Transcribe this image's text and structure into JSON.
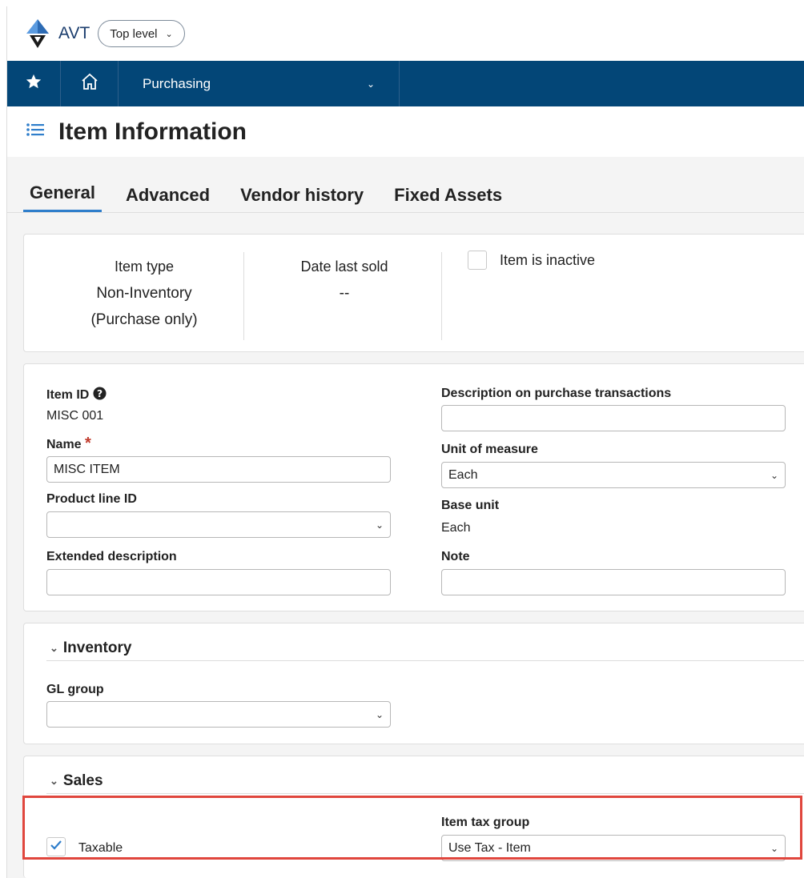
{
  "header": {
    "app_name": "AVT",
    "level_button": "Top level",
    "chevron": "⌄"
  },
  "nav": {
    "star_icon": "star-icon",
    "home_icon": "home-icon",
    "module": "Purchasing",
    "module_chevron": "⌄"
  },
  "page": {
    "title": "Item Information"
  },
  "tabs": [
    {
      "label": "General",
      "active": true
    },
    {
      "label": "Advanced",
      "active": false
    },
    {
      "label": "Vendor history",
      "active": false
    },
    {
      "label": "Fixed Assets",
      "active": false
    }
  ],
  "summary": {
    "item_type_label": "Item type",
    "item_type_value_1": "Non-Inventory",
    "item_type_value_2": "(Purchase only)",
    "date_last_sold_label": "Date last sold",
    "date_last_sold_value": "--",
    "inactive_label": "Item is inactive"
  },
  "general": {
    "item_id_label": "Item ID",
    "item_id_value": "MISC 001",
    "name_label": "Name",
    "required_mark": "*",
    "name_value": "MISC ITEM",
    "product_line_label": "Product line ID",
    "product_line_value": "",
    "extended_desc_label": "Extended description",
    "extended_desc_value": "",
    "purchase_desc_label": "Description on purchase transactions",
    "purchase_desc_value": "",
    "uom_label": "Unit of measure",
    "uom_value": "Each",
    "base_unit_label": "Base unit",
    "base_unit_value": "Each",
    "note_label": "Note",
    "note_value": ""
  },
  "inventory": {
    "section_label": "Inventory",
    "gl_group_label": "GL group",
    "gl_group_value": ""
  },
  "sales": {
    "section_label": "Sales",
    "taxable_label": "Taxable",
    "taxable_checked": true,
    "tax_group_label": "Item tax group",
    "tax_group_value": "Use Tax - Item"
  },
  "colors": {
    "nav_bg": "#034677",
    "accent": "#2f7ecb",
    "highlight": "#e0463d",
    "required": "#c0392b"
  }
}
